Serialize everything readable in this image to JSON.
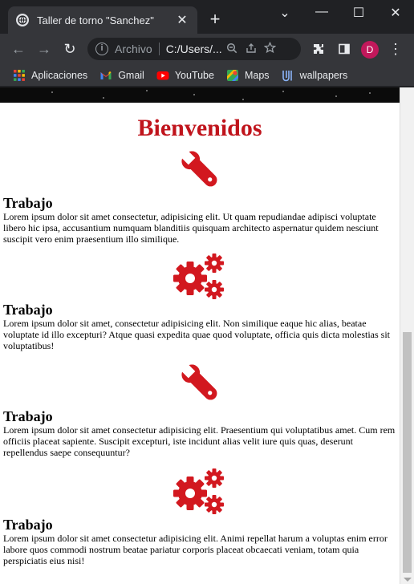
{
  "browser": {
    "tab_title": "Taller de torno \"Sanchez\"",
    "new_tab_symbol": "+",
    "close_symbol": "✕",
    "window_controls": {
      "menu": "⌄",
      "minimize": "—",
      "maximize": "☐",
      "close": "✕"
    }
  },
  "toolbar": {
    "back_icon": "←",
    "forward_icon": "→",
    "reload_icon": "↻",
    "security_label": "Archivo",
    "url": "C:/Users/...",
    "avatar_letter": "D",
    "menu_icon": "⋮"
  },
  "bookmarks": [
    {
      "label": "Aplicaciones",
      "icon": "apps-grid-icon"
    },
    {
      "label": "Gmail",
      "icon": "gmail-icon"
    },
    {
      "label": "YouTube",
      "icon": "youtube-icon"
    },
    {
      "label": "Maps",
      "icon": "maps-icon"
    },
    {
      "label": "wallpapers",
      "icon": "wallpapers-icon"
    }
  ],
  "colors": {
    "heading": "#c0141c",
    "icon": "#d2181f",
    "avatar": "#c2185b"
  },
  "page": {
    "title": "Bienvenidos",
    "sections": [
      {
        "icon": "wrench-icon",
        "heading": "Trabajo",
        "text": "Lorem ipsum dolor sit amet consectetur, adipisicing elit. Ut quam repudiandae adipisci voluptate libero hic ipsa, accusantium numquam blanditiis quisquam architecto aspernatur quidem nesciunt suscipit vero enim praesentium illo similique."
      },
      {
        "icon": "gears-icon",
        "heading": "Trabajo",
        "text": "Lorem ipsum dolor sit amet, consectetur adipisicing elit. Non similique eaque hic alias, beatae voluptate id illo excepturi? Atque quasi expedita quae quod voluptate, officia quis dicta molestias sit voluptatibus!"
      },
      {
        "icon": "wrench-icon",
        "heading": "Trabajo",
        "text": "Lorem ipsum dolor sit amet consectetur adipisicing elit. Praesentium qui voluptatibus amet. Cum rem officiis placeat sapiente. Suscipit excepturi, iste incidunt alias velit iure quis quas, deserunt repellendus saepe consequuntur?"
      },
      {
        "icon": "gears-icon",
        "heading": "Trabajo",
        "text": "Lorem ipsum dolor sit amet consectetur adipisicing elit. Animi repellat harum a voluptas enim error labore quos commodi nostrum beatae pariatur corporis placeat obcaecati veniam, totam quia perspiciatis eius nisi!"
      }
    ]
  }
}
